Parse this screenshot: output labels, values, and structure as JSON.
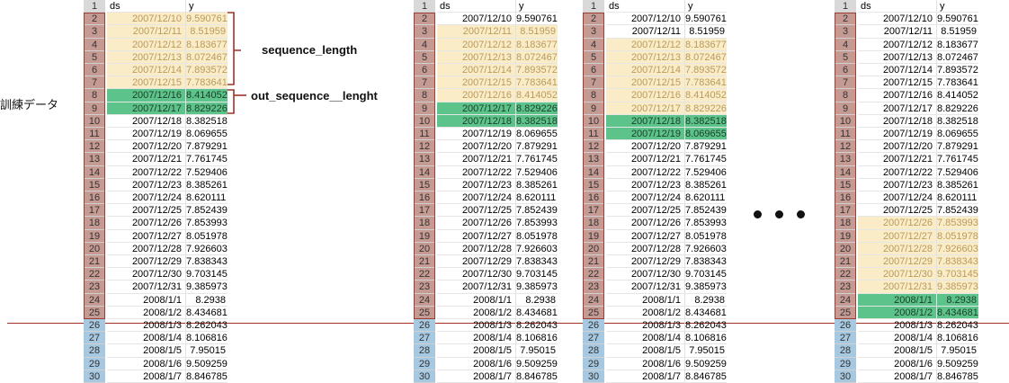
{
  "labels": {
    "train": "訓練データ",
    "seq_len": "sequence_length",
    "out_seq": "out_sequence__lenght"
  },
  "headers": [
    "1",
    "ds",
    "y"
  ],
  "rows": [
    {
      "n": "2",
      "ds": "2007/12/10",
      "y": "9.590761"
    },
    {
      "n": "3",
      "ds": "2007/12/11",
      "y": "8.51959"
    },
    {
      "n": "4",
      "ds": "2007/12/12",
      "y": "8.183677"
    },
    {
      "n": "5",
      "ds": "2007/12/13",
      "y": "8.072467"
    },
    {
      "n": "6",
      "ds": "2007/12/14",
      "y": "7.893572"
    },
    {
      "n": "7",
      "ds": "2007/12/15",
      "y": "7.783641"
    },
    {
      "n": "8",
      "ds": "2007/12/16",
      "y": "8.414052"
    },
    {
      "n": "9",
      "ds": "2007/12/17",
      "y": "8.829226"
    },
    {
      "n": "10",
      "ds": "2007/12/18",
      "y": "8.382518"
    },
    {
      "n": "11",
      "ds": "2007/12/19",
      "y": "8.069655"
    },
    {
      "n": "12",
      "ds": "2007/12/20",
      "y": "7.879291"
    },
    {
      "n": "13",
      "ds": "2007/12/21",
      "y": "7.761745"
    },
    {
      "n": "14",
      "ds": "2007/12/22",
      "y": "7.529406"
    },
    {
      "n": "15",
      "ds": "2007/12/23",
      "y": "8.385261"
    },
    {
      "n": "16",
      "ds": "2007/12/24",
      "y": "8.620111"
    },
    {
      "n": "17",
      "ds": "2007/12/25",
      "y": "7.852439"
    },
    {
      "n": "18",
      "ds": "2007/12/26",
      "y": "7.853993"
    },
    {
      "n": "19",
      "ds": "2007/12/27",
      "y": "8.051978"
    },
    {
      "n": "20",
      "ds": "2007/12/28",
      "y": "7.926603"
    },
    {
      "n": "21",
      "ds": "2007/12/29",
      "y": "7.838343"
    },
    {
      "n": "22",
      "ds": "2007/12/30",
      "y": "9.703145"
    },
    {
      "n": "23",
      "ds": "2007/12/31",
      "y": "9.385973"
    },
    {
      "n": "24",
      "ds": "2008/1/1",
      "y": "8.2938"
    },
    {
      "n": "25",
      "ds": "2008/1/2",
      "y": "8.434681"
    },
    {
      "n": "26",
      "ds": "2008/1/3",
      "y": "8.262043"
    },
    {
      "n": "27",
      "ds": "2008/1/4",
      "y": "8.106816"
    },
    {
      "n": "28",
      "ds": "2008/1/5",
      "y": "7.95015"
    },
    {
      "n": "29",
      "ds": "2008/1/6",
      "y": "9.509259"
    },
    {
      "n": "30",
      "ds": "2008/1/7",
      "y": "8.846785"
    }
  ],
  "windows": [
    {
      "seq": [
        0,
        5
      ],
      "out": [
        6,
        7
      ]
    },
    {
      "seq": [
        1,
        6
      ],
      "out": [
        7,
        8
      ]
    },
    {
      "seq": [
        2,
        7
      ],
      "out": [
        8,
        9
      ]
    },
    {
      "seq": [
        16,
        21
      ],
      "out": [
        22,
        23
      ]
    }
  ],
  "train_row_count": 24,
  "colors": {
    "sequence_fill": "#fbecc8",
    "output_fill": "#5cc48a",
    "train_rownum": "#c59a92",
    "test_rownum": "#a6c8e0",
    "split_line": "#a0322a",
    "brace": "#a0322a"
  }
}
